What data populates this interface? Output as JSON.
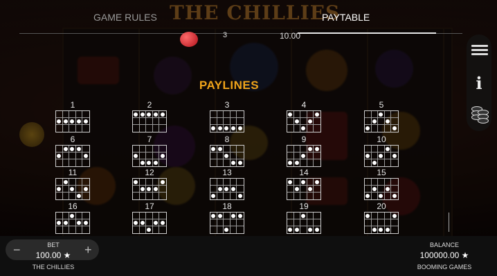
{
  "header": {
    "background_title": "THE CHILLIES",
    "tabs": [
      {
        "label": "GAME RULES"
      },
      {
        "label": "PAYTABLE"
      }
    ],
    "active_tab": "PAYTABLE"
  },
  "paytable_row": {
    "count": "3",
    "value": "10.00"
  },
  "paylines": {
    "title": "PAYLINES",
    "lines": [
      {
        "label": "1",
        "rows": [
          1,
          1,
          1,
          1,
          1
        ]
      },
      {
        "label": "2",
        "rows": [
          0,
          0,
          0,
          0,
          0
        ]
      },
      {
        "label": "3",
        "rows": [
          2,
          2,
          2,
          2,
          2
        ]
      },
      {
        "label": "4",
        "rows": [
          0,
          1,
          2,
          1,
          0
        ]
      },
      {
        "label": "5",
        "rows": [
          2,
          1,
          0,
          1,
          2
        ]
      },
      {
        "label": "6",
        "rows": [
          1,
          0,
          0,
          0,
          1
        ]
      },
      {
        "label": "7",
        "rows": [
          1,
          2,
          2,
          2,
          1
        ]
      },
      {
        "label": "8",
        "rows": [
          0,
          0,
          1,
          2,
          2
        ]
      },
      {
        "label": "9",
        "rows": [
          2,
          2,
          1,
          0,
          0
        ]
      },
      {
        "label": "10",
        "rows": [
          1,
          2,
          1,
          0,
          1
        ]
      },
      {
        "label": "11",
        "rows": [
          1,
          0,
          1,
          2,
          1
        ]
      },
      {
        "label": "12",
        "rows": [
          0,
          1,
          1,
          1,
          0
        ]
      },
      {
        "label": "13",
        "rows": [
          2,
          1,
          1,
          1,
          2
        ]
      },
      {
        "label": "14",
        "rows": [
          0,
          1,
          0,
          1,
          0
        ]
      },
      {
        "label": "15",
        "rows": [
          2,
          1,
          2,
          1,
          2
        ]
      },
      {
        "label": "16",
        "rows": [
          1,
          1,
          0,
          1,
          1
        ]
      },
      {
        "label": "17",
        "rows": [
          1,
          1,
          2,
          1,
          1
        ]
      },
      {
        "label": "18",
        "rows": [
          0,
          0,
          2,
          0,
          0
        ]
      },
      {
        "label": "19",
        "rows": [
          2,
          2,
          0,
          2,
          2
        ]
      },
      {
        "label": "20",
        "rows": [
          0,
          2,
          2,
          2,
          0
        ]
      }
    ]
  },
  "side_menu": {
    "items": [
      {
        "icon": "menu-icon"
      },
      {
        "icon": "info-icon",
        "glyph": "i"
      },
      {
        "icon": "coins-icon"
      }
    ]
  },
  "bottom_bar": {
    "bet_label": "BET",
    "bet_value": "100.00 ★",
    "bet_minus": "−",
    "bet_plus": "+",
    "game_name": "THE CHILLIES",
    "balance_label": "BALANCE",
    "balance_value": "100000.00 ★",
    "studio_name": "BOOMING GAMES"
  },
  "colors": {
    "accent": "#f0a41a",
    "background": "#1b0f0a"
  }
}
